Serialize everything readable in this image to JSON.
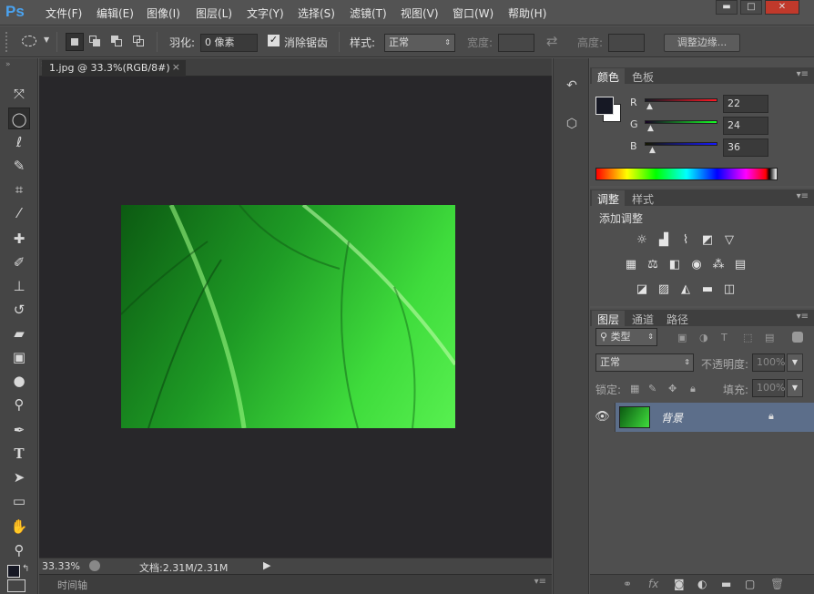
{
  "app": {
    "logo": "Ps"
  },
  "menu": [
    "文件(F)",
    "编辑(E)",
    "图像(I)",
    "图层(L)",
    "文字(Y)",
    "选择(S)",
    "滤镜(T)",
    "视图(V)",
    "窗口(W)",
    "帮助(H)"
  ],
  "window_controls": {
    "minimize": "▬",
    "restore": "□",
    "close": "✕"
  },
  "options": {
    "feather_label": "羽化:",
    "feather_value": "0 像素",
    "antialias_label": "消除锯齿",
    "style_label": "样式:",
    "style_value": "正常",
    "width_label": "宽度:",
    "height_label": "高度:",
    "refine_button": "调整边缘..."
  },
  "document": {
    "tab_title": "1.jpg @ 33.3%(RGB/8#)",
    "close": "×"
  },
  "status": {
    "zoom": "33.33%",
    "doc_info": "文档:2.31M/2.31M"
  },
  "timeline": {
    "label": "时间轴"
  },
  "color_panel": {
    "tabs": [
      "颜色",
      "色板"
    ],
    "channels": [
      {
        "name": "R",
        "value": "22",
        "color": "#e02020"
      },
      {
        "name": "G",
        "value": "24",
        "color": "#20c020"
      },
      {
        "name": "B",
        "value": "36",
        "color": "#2040e0"
      }
    ],
    "foreground": "#161824",
    "background": "#ffffff"
  },
  "adjust_panel": {
    "tabs": [
      "调整",
      "样式"
    ],
    "title": "添加调整"
  },
  "layers_panel": {
    "tabs": [
      "图层",
      "通道",
      "路径"
    ],
    "filter_label": "类型",
    "blend_mode": "正常",
    "opacity_label": "不透明度:",
    "opacity_value": "100%",
    "lock_label": "锁定:",
    "fill_label": "填充:",
    "fill_value": "100%",
    "layers": [
      {
        "name": "背景",
        "visible": true,
        "locked": true
      }
    ]
  }
}
